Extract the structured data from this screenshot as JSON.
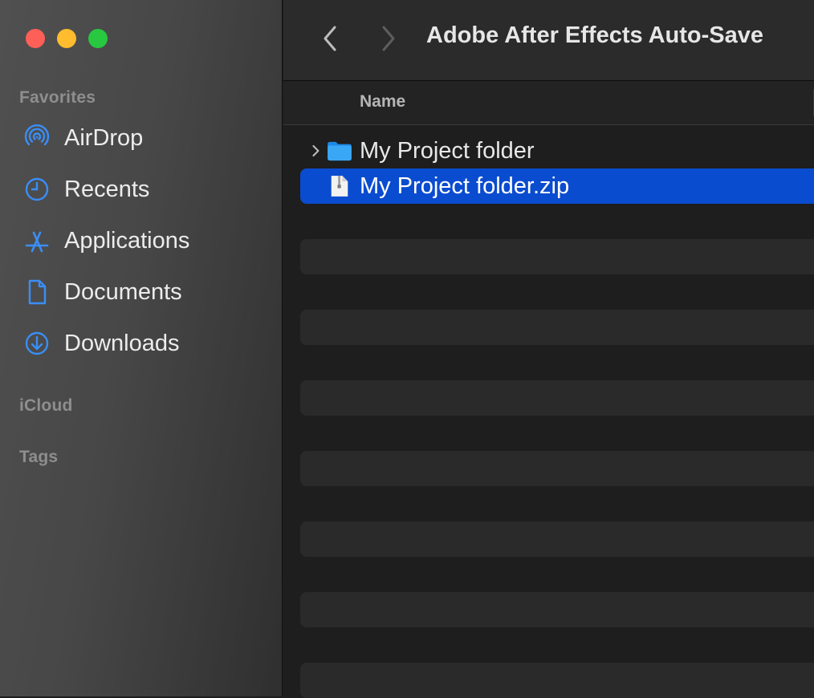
{
  "window": {
    "title": "Adobe After Effects Auto-Save"
  },
  "sidebar": {
    "favorites_title": "Favorites",
    "items": [
      {
        "label": "AirDrop",
        "icon": "airdrop-icon"
      },
      {
        "label": "Recents",
        "icon": "clock-icon"
      },
      {
        "label": "Applications",
        "icon": "applications-icon"
      },
      {
        "label": "Documents",
        "icon": "document-icon"
      },
      {
        "label": "Downloads",
        "icon": "download-icon"
      }
    ],
    "icloud_title": "iCloud",
    "tags_title": "Tags"
  },
  "columns": {
    "name": "Name"
  },
  "files": [
    {
      "name": "My Project folder",
      "kind": "folder",
      "icon": "folder-icon",
      "expandable": true,
      "selected": false
    },
    {
      "name": "My Project folder.zip",
      "kind": "zip",
      "icon": "zip-file-icon",
      "expandable": false,
      "selected": true
    }
  ],
  "colors": {
    "accent": "#3a8ef7",
    "selection": "#0a4ccf",
    "close": "#fe5f57",
    "minimize": "#febc2e",
    "zoom": "#28c840",
    "folder": "#3aa7f5"
  }
}
